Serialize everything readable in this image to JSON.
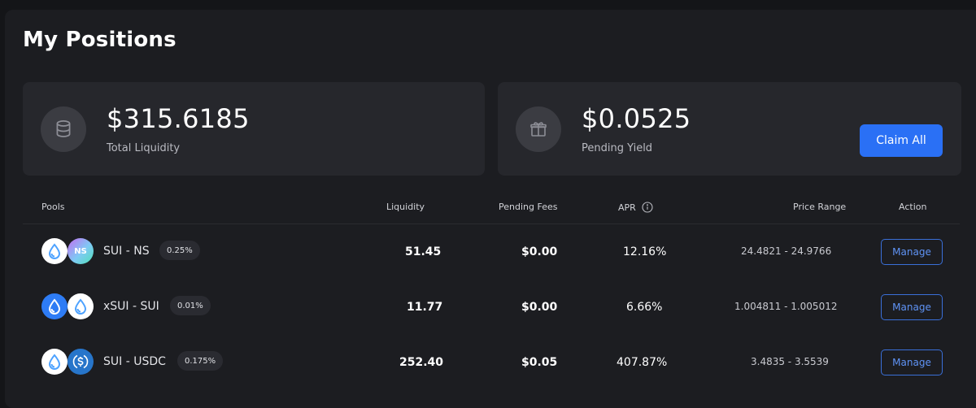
{
  "title": "My Positions",
  "summary": {
    "total_liquidity": {
      "value": "$315.6185",
      "label": "Total Liquidity",
      "icon": "coins-stack-icon"
    },
    "pending_yield": {
      "value": "$0.0525",
      "label": "Pending Yield",
      "icon": "gift-icon"
    },
    "claim_label": "Claim All"
  },
  "table": {
    "headers": {
      "pools": "Pools",
      "liquidity": "Liquidity",
      "pending_fees": "Pending Fees",
      "apr": "APR",
      "price_range": "Price Range",
      "action": "Action"
    },
    "rows": [
      {
        "pair": "SUI - NS",
        "fee": "0.25%",
        "liquidity": "51.45",
        "pending_fees": "$0.00",
        "apr": "12.16%",
        "price_range": "24.4821 - 24.9766",
        "action": "Manage",
        "coin_a": "sui-icon",
        "coin_b": "ns-icon",
        "coin_b_text": "NS"
      },
      {
        "pair": "xSUI - SUI",
        "fee": "0.01%",
        "liquidity": "11.77",
        "pending_fees": "$0.00",
        "apr": "6.66%",
        "price_range": "1.004811 - 1.005012",
        "action": "Manage",
        "coin_a": "xsui-icon",
        "coin_b": "sui-icon"
      },
      {
        "pair": "SUI - USDC",
        "fee": "0.175%",
        "liquidity": "252.40",
        "pending_fees": "$0.05",
        "apr": "407.87%",
        "price_range": "3.4835 - 3.5539",
        "action": "Manage",
        "coin_a": "sui-icon",
        "coin_b": "usdc-icon"
      }
    ]
  },
  "colors": {
    "accent": "#2a70f5",
    "sui": "#4da2ff",
    "panel": "#1c1d21",
    "card": "#26272c"
  }
}
